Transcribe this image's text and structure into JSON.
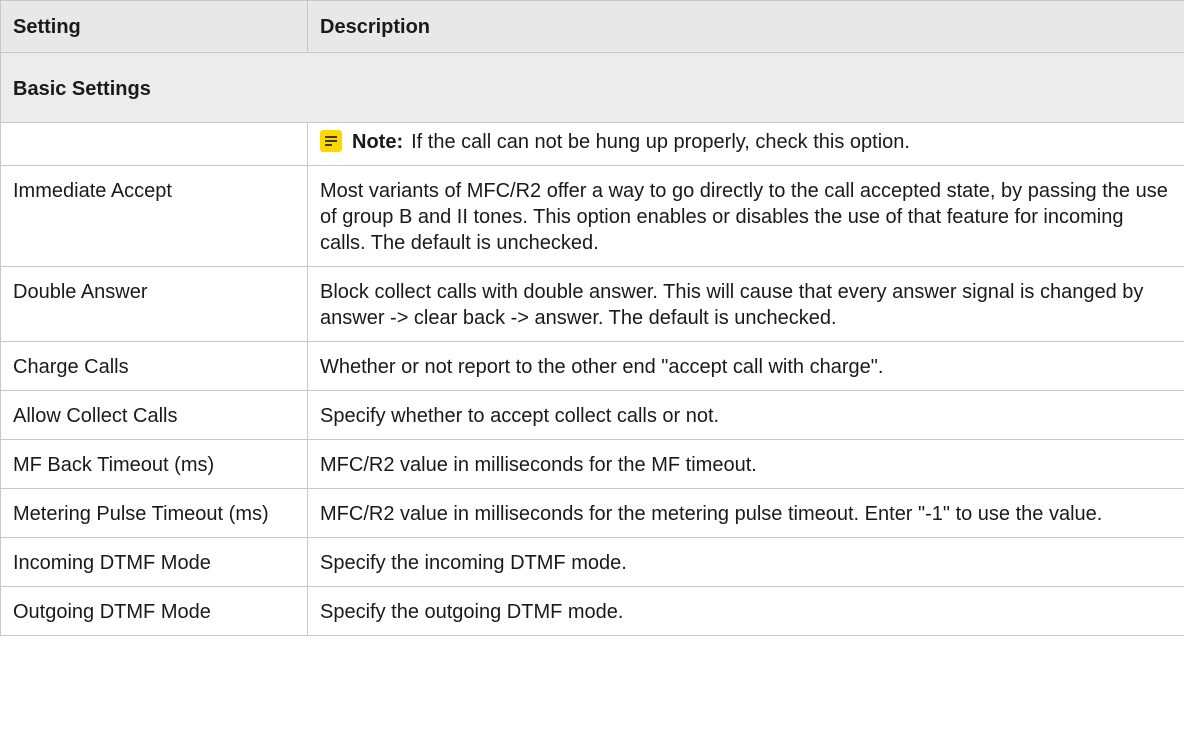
{
  "table": {
    "headers": {
      "setting": "Setting",
      "description": "Description"
    },
    "section_title": "Basic Settings",
    "note": {
      "label": "Note:",
      "text": "If the call can not be hung up properly, check this option."
    },
    "rows": [
      {
        "setting": "Immediate Accept",
        "description": "Most variants of MFC/R2 offer a way to go directly to the call accepted state, by passing the use of group B and II tones. This option enables or disables the use of that feature for incoming calls. The default is unchecked."
      },
      {
        "setting": "Double Answer",
        "description": "Block collect calls with double answer. This will cause that every answer signal is changed by answer -> clear back -> answer. The default is unchecked."
      },
      {
        "setting": "Charge Calls",
        "description": "Whether or not report to the other end \"accept call with charge\"."
      },
      {
        "setting": "Allow Collect Calls",
        "description": "Specify whether to accept collect calls or not."
      },
      {
        "setting": "MF Back Timeout (ms)",
        "description": "MFC/R2 value in milliseconds for the MF timeout."
      },
      {
        "setting": "Metering Pulse Timeout (ms)",
        "description": "MFC/R2 value in milliseconds for the metering pulse timeout. Enter \"-1\" to use the value."
      },
      {
        "setting": "Incoming DTMF Mode",
        "description": "Specify the incoming DTMF mode."
      },
      {
        "setting": "Outgoing DTMF Mode",
        "description": "Specify the outgoing DTMF mode."
      }
    ]
  }
}
